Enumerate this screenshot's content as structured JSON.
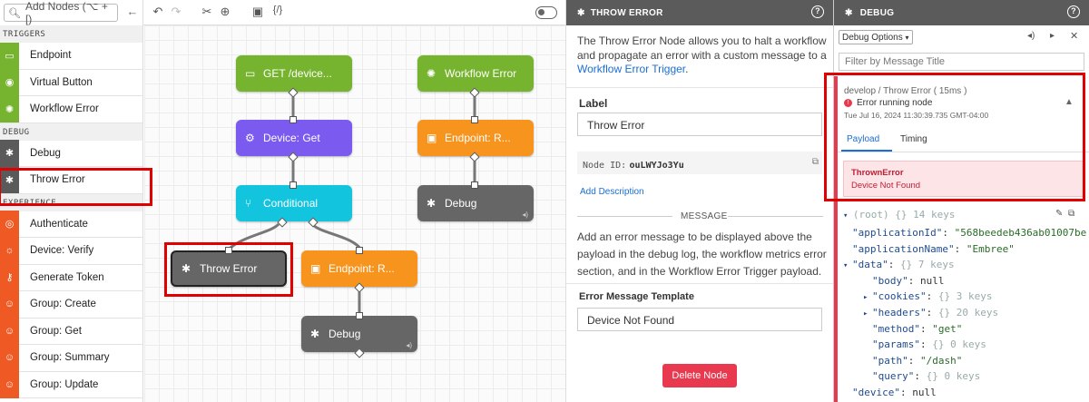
{
  "palette": {
    "search_placeholder": "Add Nodes (⌥ + [)",
    "sections": [
      {
        "title": "TRIGGERS",
        "items": [
          {
            "label": "Endpoint",
            "icon": "endpoint-icon"
          },
          {
            "label": "Virtual Button",
            "icon": "virtual-button-icon"
          },
          {
            "label": "Workflow Error",
            "icon": "gear-error-icon"
          }
        ]
      },
      {
        "title": "DEBUG",
        "items": [
          {
            "label": "Debug",
            "icon": "bug-icon"
          },
          {
            "label": "Throw Error",
            "icon": "error-icon"
          }
        ]
      },
      {
        "title": "EXPERIENCE",
        "items": [
          {
            "label": "Authenticate",
            "icon": "fingerprint-icon"
          },
          {
            "label": "Device: Verify",
            "icon": "device-verify-icon"
          },
          {
            "label": "Generate Token",
            "icon": "key-icon"
          },
          {
            "label": "Group: Create",
            "icon": "group-add-icon"
          },
          {
            "label": "Group: Get",
            "icon": "group-icon"
          },
          {
            "label": "Group: Summary",
            "icon": "group-summary-icon"
          },
          {
            "label": "Group: Update",
            "icon": "group-update-icon"
          }
        ]
      }
    ]
  },
  "canvas": {
    "nodes": [
      {
        "id": "get",
        "label": "GET /device...",
        "color": "#76b32e"
      },
      {
        "id": "device",
        "label": "Device: Get",
        "color": "#7b5af0"
      },
      {
        "id": "cond",
        "label": "Conditional",
        "color": "#12c4de"
      },
      {
        "id": "throw",
        "label": "Throw Error",
        "color": "#666666"
      },
      {
        "id": "ep1",
        "label": "Endpoint: R...",
        "color": "#f7941d"
      },
      {
        "id": "dbg1",
        "label": "Debug",
        "color": "#666666"
      },
      {
        "id": "wf",
        "label": "Workflow Error",
        "color": "#76b32e"
      },
      {
        "id": "ep2",
        "label": "Endpoint: R...",
        "color": "#f7941d"
      },
      {
        "id": "dbg2",
        "label": "Debug",
        "color": "#666666"
      }
    ]
  },
  "properties": {
    "header": "THROW ERROR",
    "description": "The Throw Error Node allows you to halt a workflow and propagate an error with a custom message to a",
    "description_link": "Workflow Error Trigger",
    "description_end": ".",
    "label_title": "Label",
    "label_value": "Throw Error",
    "node_id_label": "Node ID:",
    "node_id_value": "ouLWYJo3Yu",
    "add_description": "Add Description",
    "message_section": "MESSAGE",
    "message_description": "Add an error message to be displayed above the payload in the debug log, the workflow metrics error section, and in the Workflow Error Trigger payload.",
    "template_title": "Error Message Template",
    "template_value": "Device Not Found",
    "delete_button": "Delete Node"
  },
  "debug": {
    "header": "DEBUG",
    "options_label": "Debug Options",
    "filter_placeholder": "Filter by Message Title",
    "entry": {
      "title": "develop / Throw Error ( 15ms )",
      "status": "Error running node",
      "timestamp": "Tue Jul 16, 2024 11:30:39.735 GMT-04:00"
    },
    "tabs": [
      "Payload",
      "Timing"
    ],
    "error": {
      "name": "ThrownError",
      "message": "Device Not Found"
    },
    "tree": {
      "root": "(root)",
      "root_count": "14 keys",
      "rows": [
        {
          "indent": 1,
          "key": "\"applicationId\"",
          "value": "\"568beedeb436ab01007be",
          "kind": "str"
        },
        {
          "indent": 1,
          "key": "\"applicationName\"",
          "value": "\"Embree\"",
          "kind": "str"
        },
        {
          "indent": 1,
          "key": "\"data\"",
          "value": "{}",
          "extra": "7 keys",
          "kind": "obj",
          "toggle": "▾"
        },
        {
          "indent": 2,
          "key": "\"body\"",
          "value": "null",
          "kind": "null"
        },
        {
          "indent": 2,
          "key": "\"cookies\"",
          "value": "{}",
          "extra": "3 keys",
          "kind": "obj",
          "toggle": "▸"
        },
        {
          "indent": 2,
          "key": "\"headers\"",
          "value": "{}",
          "extra": "20 keys",
          "kind": "obj",
          "toggle": "▸"
        },
        {
          "indent": 2,
          "key": "\"method\"",
          "value": "\"get\"",
          "kind": "str"
        },
        {
          "indent": 2,
          "key": "\"params\"",
          "value": "{}",
          "extra": "0 keys",
          "kind": "obj"
        },
        {
          "indent": 2,
          "key": "\"path\"",
          "value": "\"/dash\"",
          "kind": "str"
        },
        {
          "indent": 2,
          "key": "\"query\"",
          "value": "{}",
          "extra": "0 keys",
          "kind": "obj"
        },
        {
          "indent": 1,
          "key": "\"device\"",
          "value": "null",
          "kind": "null"
        }
      ]
    }
  }
}
